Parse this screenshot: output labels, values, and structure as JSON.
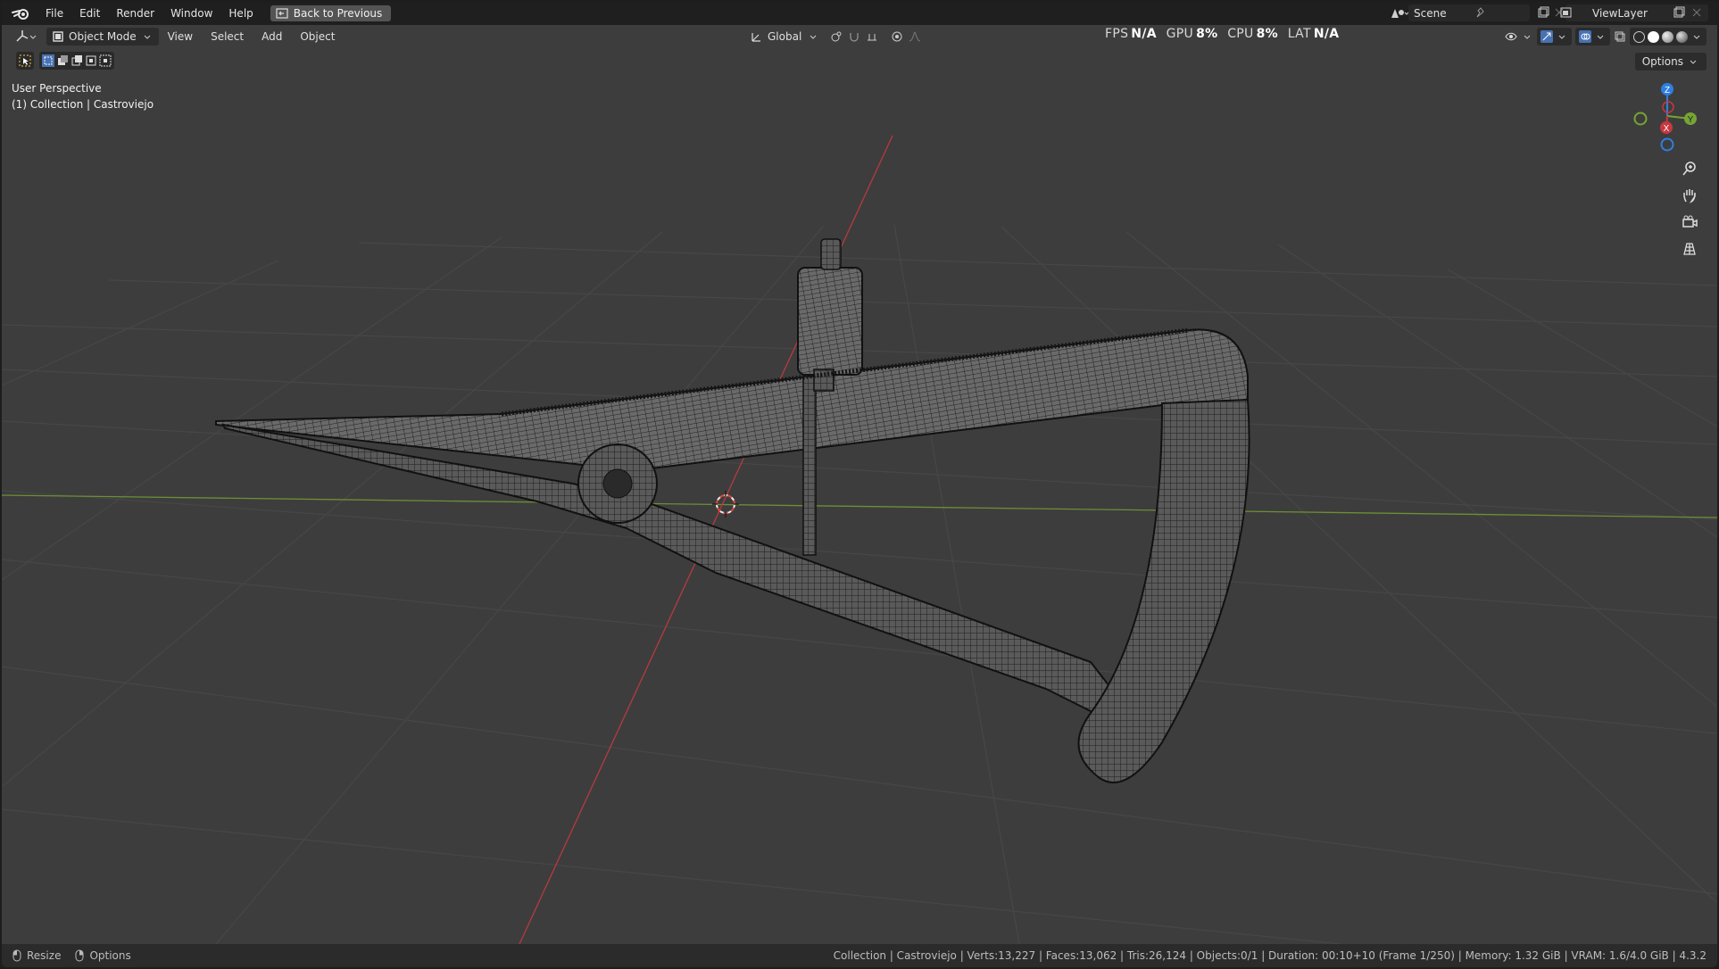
{
  "menu": {
    "items": [
      "File",
      "Edit",
      "Render",
      "Window",
      "Help"
    ],
    "back_button": "Back to Previous"
  },
  "scene": {
    "name": "Scene"
  },
  "view_layer": {
    "name": "ViewLayer"
  },
  "viewport_header": {
    "mode": "Object Mode",
    "menus": [
      "View",
      "Select",
      "Add",
      "Object"
    ],
    "orientation": "Global"
  },
  "stats": {
    "fps_label": "FPS",
    "fps": "N/A",
    "gpu_label": "GPU",
    "gpu": "8%",
    "cpu_label": "CPU",
    "cpu": "8%",
    "lat_label": "LAT",
    "lat": "N/A"
  },
  "options_label": "Options",
  "overlay": {
    "perspective": "User Perspective",
    "collection": "(1) Collection | Castroviejo"
  },
  "gizmo": {
    "z": "Z",
    "y": "Y",
    "x": "X"
  },
  "status": {
    "resize": "Resize",
    "options": "Options",
    "info": "Collection | Castroviejo | Verts:13,227 | Faces:13,062 | Tris:26,124 | Objects:0/1 | Duration: 00:10+10 (Frame 1/250) | Memory: 1.32 GiB | VRAM: 1.6/4.0 GiB | 4.3.2"
  },
  "colors": {
    "viewport_bg": "#3d3d3d",
    "x_axis": "#c8383f",
    "y_axis": "#76a534",
    "z_axis": "#2f7fe0"
  }
}
